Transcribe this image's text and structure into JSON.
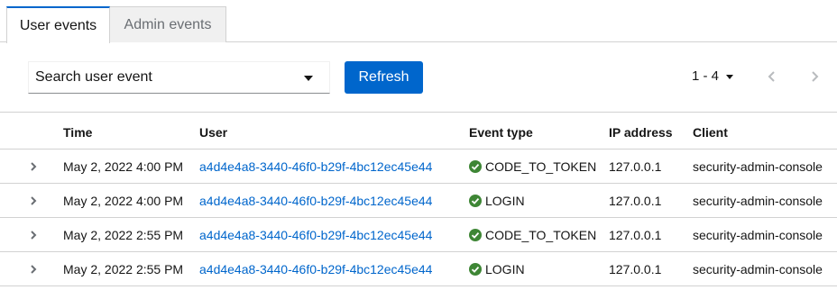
{
  "tabs": {
    "user_events": "User events",
    "admin_events": "Admin events"
  },
  "toolbar": {
    "search_placeholder": "Search user event",
    "refresh_label": "Refresh"
  },
  "pagination": {
    "range": "1 - 4"
  },
  "table": {
    "headers": {
      "time": "Time",
      "user": "User",
      "event_type": "Event type",
      "ip_address": "IP address",
      "client": "Client"
    },
    "rows": [
      {
        "time": "May 2, 2022 4:00 PM",
        "user": "a4d4e4a8-3440-46f0-b29f-4bc12ec45e44",
        "event_type": "CODE_TO_TOKEN",
        "ip": "127.0.0.1",
        "client": "security-admin-console"
      },
      {
        "time": "May 2, 2022 4:00 PM",
        "user": "a4d4e4a8-3440-46f0-b29f-4bc12ec45e44",
        "event_type": "LOGIN",
        "ip": "127.0.0.1",
        "client": "security-admin-console"
      },
      {
        "time": "May 2, 2022 2:55 PM",
        "user": "a4d4e4a8-3440-46f0-b29f-4bc12ec45e44",
        "event_type": "CODE_TO_TOKEN",
        "ip": "127.0.0.1",
        "client": "security-admin-console"
      },
      {
        "time": "May 2, 2022 2:55 PM",
        "user": "a4d4e4a8-3440-46f0-b29f-4bc12ec45e44",
        "event_type": "LOGIN",
        "ip": "127.0.0.1",
        "client": "security-admin-console"
      }
    ]
  },
  "icons": {
    "expand": "chevron-right-icon",
    "status": "check-circle-icon",
    "prev": "chevron-left-icon",
    "next": "chevron-right-icon"
  },
  "colors": {
    "accent": "#0066cc",
    "success": "#3e8635"
  }
}
